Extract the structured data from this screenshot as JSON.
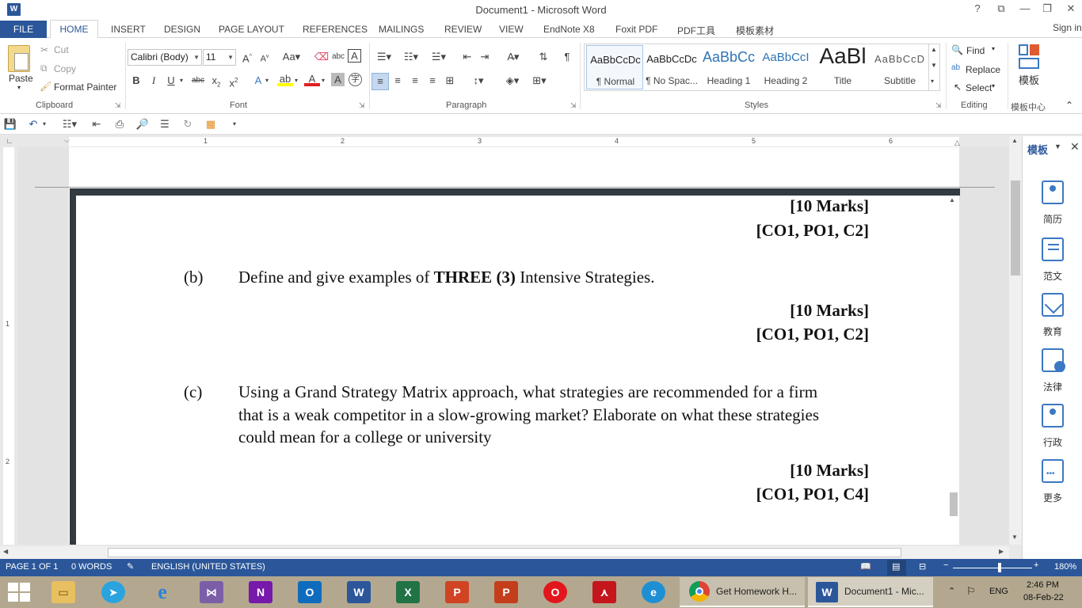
{
  "window": {
    "title": "Document1 - Microsoft Word",
    "app_icon_letter": "W",
    "help": "?",
    "restore_ribbon": "⧉",
    "minimize": "—",
    "maximize": "❐",
    "close": "✕",
    "signin": "Sign in"
  },
  "tabs": [
    "FILE",
    "HOME",
    "INSERT",
    "DESIGN",
    "PAGE LAYOUT",
    "REFERENCES",
    "MAILINGS",
    "REVIEW",
    "VIEW",
    "EndNote X8",
    "Foxit PDF",
    "PDF工具",
    "模板素材"
  ],
  "ribbon": {
    "clipboard": {
      "paste": "Paste",
      "cut": "Cut",
      "copy": "Copy",
      "format_painter": "Format Painter",
      "label": "Clipboard"
    },
    "font": {
      "family": "Calibri (Body)",
      "size": "11",
      "label": "Font"
    },
    "paragraph": {
      "label": "Paragraph"
    },
    "styles": {
      "label": "Styles",
      "items": [
        {
          "sample": "AaBbCcDc",
          "name": "¶ Normal"
        },
        {
          "sample": "AaBbCcDc",
          "name": "¶ No Spac..."
        },
        {
          "sample": "AaBbCc",
          "name": "Heading 1"
        },
        {
          "sample": "AaBbCcI",
          "name": "Heading 2"
        },
        {
          "sample": "AaBl",
          "name": "Title"
        },
        {
          "sample": "AaBbCcD",
          "name": "Subtitle"
        }
      ]
    },
    "editing": {
      "find": "Find",
      "replace": "Replace",
      "select": "Select",
      "label": "Editing"
    },
    "template": {
      "button": "模板",
      "label": "模板中心"
    }
  },
  "ruler": {
    "numbers": [
      "1",
      "2",
      "3",
      "4",
      "5",
      "6"
    ],
    "left_numbers": [
      "1",
      "2"
    ]
  },
  "document": {
    "mark_top_1": "[10 Marks]",
    "mark_top_2": "[CO1, PO1, C2]",
    "q_b_label": "(b)",
    "q_b_text_pre": "Define and give examples of ",
    "q_b_text_bold": "THREE (3)",
    "q_b_text_post": " Intensive Strategies.",
    "mark_b_1": "[10 Marks]",
    "mark_b_2": "[CO1, PO1, C2]",
    "q_c_label": "(c)",
    "q_c_line1": "Using a Grand Strategy Matrix approach, what strategies are recommended for a firm",
    "q_c_line2": "that is a weak competitor in a slow-growing market? Elaborate on what these strategies",
    "q_c_line3": "could mean for a college or university",
    "mark_c_1": "[10 Marks]",
    "mark_c_2": "[CO1, PO1, C4]"
  },
  "pane": {
    "title": "模板",
    "items": [
      "简历",
      "范文",
      "教育",
      "法律",
      "行政",
      "更多"
    ]
  },
  "status": {
    "page": "PAGE 1 OF 1",
    "words": "0 WORDS",
    "language": "ENGLISH (UNITED STATES)",
    "zoom": "180%"
  },
  "taskbar": {
    "chrome_task": "Get Homework H...",
    "word_task": "Document1 - Mic...",
    "lang": "ENG",
    "time": "2:46 PM",
    "date": "08-Feb-22"
  }
}
